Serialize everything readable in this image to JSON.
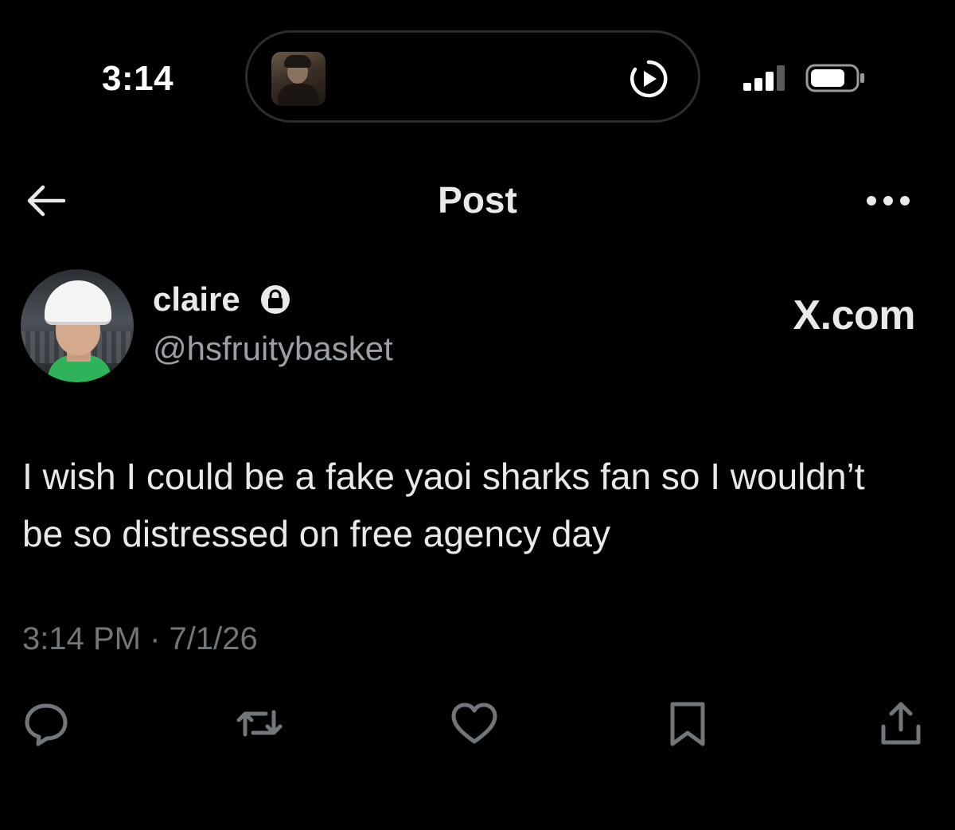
{
  "status_bar": {
    "time": "3:14"
  },
  "dynamic_island": {
    "thumbnail": "now-playing-thumbnail",
    "icon": "play-circle-icon"
  },
  "header": {
    "title": "Post",
    "back_icon": "arrow-left-icon",
    "more_icon": "more-dots-icon"
  },
  "author": {
    "name": "claire",
    "handle": "@hsfruitybasket",
    "protected_icon": "lock-icon"
  },
  "watermark": "X.com",
  "post": {
    "text": "I wish I could be a fake yaoi sharks fan so I wouldn’t be so distressed on free agency day",
    "timestamp": "3:14 PM · 7/1/26"
  },
  "actions": [
    {
      "name": "reply",
      "icon": "reply-icon"
    },
    {
      "name": "repost",
      "icon": "repost-icon"
    },
    {
      "name": "like",
      "icon": "heart-icon"
    },
    {
      "name": "bookmark",
      "icon": "bookmark-icon"
    },
    {
      "name": "share",
      "icon": "share-icon"
    }
  ],
  "colors": {
    "background": "#000000",
    "text_primary": "#e7e9ea",
    "text_secondary": "#71767b",
    "handle": "#9aa0a6",
    "icon": "#71767b"
  }
}
